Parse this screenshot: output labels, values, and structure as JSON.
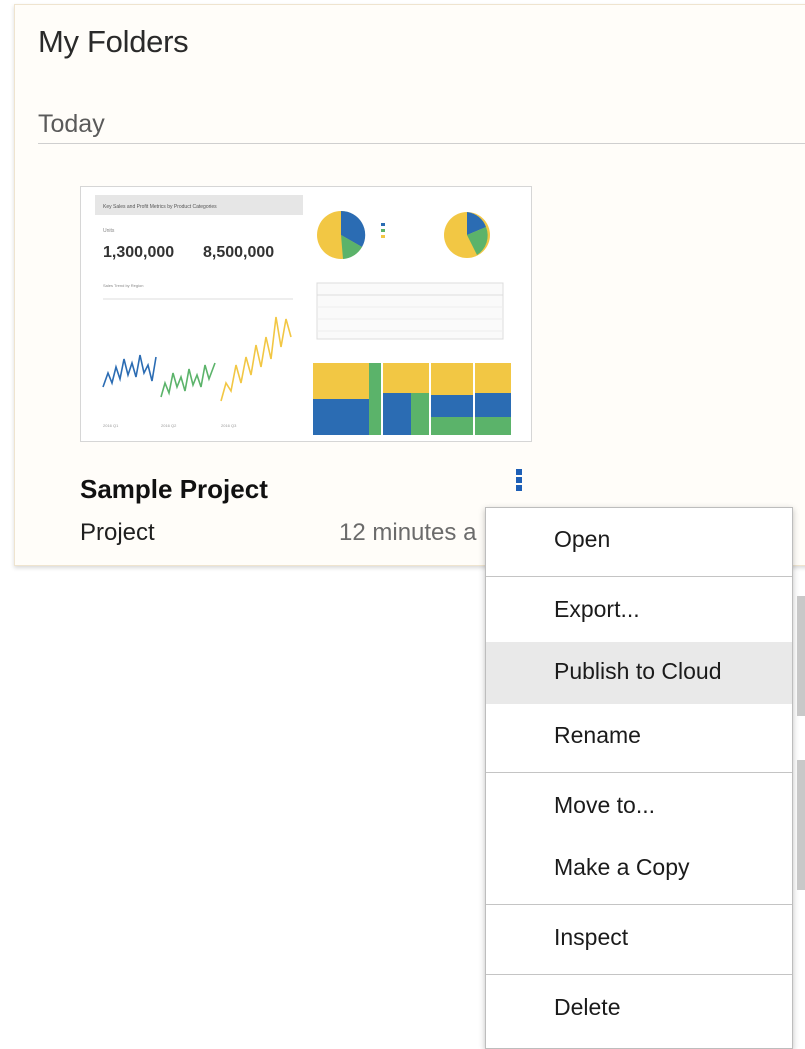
{
  "header": {
    "title": "My Folders"
  },
  "section": {
    "label": "Today"
  },
  "item": {
    "name": "Sample Project",
    "type": "Project",
    "modified": "12 minutes a",
    "thumbnail": {
      "banner": "Key Sales and Profit Metrics by Product Categories",
      "kpi_left": "1,300,000",
      "kpi_right": "8,500,000"
    }
  },
  "context_menu": {
    "items": [
      {
        "label": "Open"
      },
      {
        "label": "Export..."
      },
      {
        "label": "Publish to Cloud"
      },
      {
        "label": "Rename"
      },
      {
        "label": "Move to..."
      },
      {
        "label": "Make a Copy"
      },
      {
        "label": "Inspect"
      },
      {
        "label": "Delete"
      }
    ],
    "highlighted": "Publish to Cloud"
  },
  "colors": {
    "accent_blue": "#1d5fb6",
    "chart_blue": "#2b6cb3",
    "chart_green": "#5bb36a",
    "chart_yellow": "#f2c744",
    "menu_hover": "#e9e9e9"
  },
  "icons": {
    "more": "kebab-vertical-icon"
  }
}
